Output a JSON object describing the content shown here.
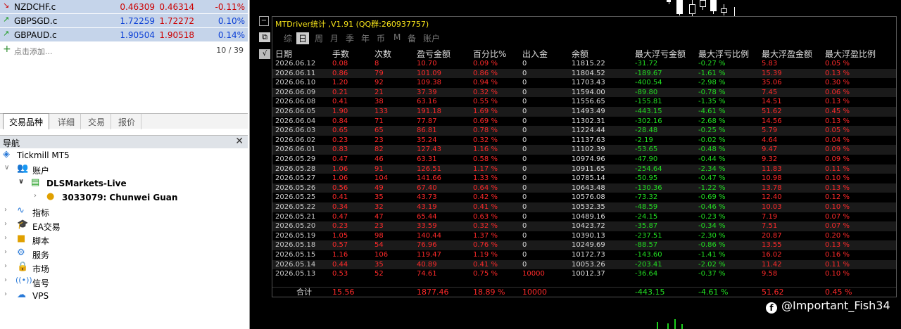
{
  "market_watch": {
    "rows": [
      {
        "dir": "down",
        "symbol": "NZDCHF.c",
        "bid": "0.46309",
        "ask": "0.46314",
        "change": "-0.11%"
      },
      {
        "dir": "up",
        "symbol": "GBPSGD.c",
        "bid": "1.72259",
        "ask": "1.72272",
        "change": "0.10%"
      },
      {
        "dir": "up",
        "symbol": "GBPAUD.c",
        "bid": "1.90504",
        "ask": "1.90518",
        "change": "0.14%"
      }
    ],
    "add_label": "点击添加...",
    "count": "10 / 39"
  },
  "bottom_tabs": [
    "交易品种",
    "详细",
    "交易",
    "报价"
  ],
  "navigator": {
    "title": "导航",
    "items": [
      {
        "label": "Tickmill MT5",
        "icon": "terminal-icon"
      },
      {
        "label": "账户",
        "icon": "accounts-icon"
      },
      {
        "label": "DLSMarkets-Live",
        "icon": "server-icon"
      },
      {
        "label": "3033079: Chunwei Guan",
        "icon": "user-icon"
      },
      {
        "label": "指标",
        "icon": "indicator-icon"
      },
      {
        "label": "EA交易",
        "icon": "expert-icon"
      },
      {
        "label": "脚本",
        "icon": "script-icon"
      },
      {
        "label": "服务",
        "icon": "service-icon"
      },
      {
        "label": "市场",
        "icon": "market-icon"
      },
      {
        "label": "信号",
        "icon": "signal-icon"
      },
      {
        "label": "VPS",
        "icon": "cloud-icon"
      }
    ]
  },
  "stats_panel": {
    "title": "MTDriver统计 ,V1.91 (QQ群:260937757)",
    "tabs": [
      "综",
      "日",
      "周",
      "月",
      "季",
      "年",
      "币",
      "M",
      "备",
      "账户"
    ],
    "active_tab": "日",
    "columns": [
      "日期",
      "手数",
      "次数",
      "盈亏金额",
      "百分比%",
      "出入金",
      "余额",
      "最大浮亏金额",
      "最大浮亏比例",
      "最大浮盈金额",
      "最大浮盈比例"
    ],
    "rows": [
      [
        "2026.06.12",
        "0.08",
        "8",
        "10.70",
        "0.09 %",
        "0",
        "11815.22",
        "-31.72",
        "-0.27 %",
        "5.83",
        "0.05 %"
      ],
      [
        "2026.06.11",
        "0.86",
        "79",
        "101.09",
        "0.86 %",
        "0",
        "11804.52",
        "-189.67",
        "-1.61 %",
        "15.39",
        "0.13 %"
      ],
      [
        "2026.06.10",
        "1.20",
        "92",
        "109.38",
        "0.94 %",
        "0",
        "11703.43",
        "-400.54",
        "-2.98 %",
        "35.06",
        "0.30 %"
      ],
      [
        "2026.06.09",
        "0.21",
        "21",
        "37.39",
        "0.32 %",
        "0",
        "11594.00",
        "-89.80",
        "-0.78 %",
        "7.45",
        "0.06 %"
      ],
      [
        "2026.06.08",
        "0.41",
        "38",
        "63.16",
        "0.55 %",
        "0",
        "11556.65",
        "-155.81",
        "-1.35 %",
        "14.51",
        "0.13 %"
      ],
      [
        "2026.06.05",
        "1.90",
        "133",
        "191.18",
        "1.69 %",
        "0",
        "11493.49",
        "-443.15",
        "-4.61 %",
        "51.62",
        "0.45 %"
      ],
      [
        "2026.06.04",
        "0.84",
        "71",
        "77.87",
        "0.69 %",
        "0",
        "11302.31",
        "-302.16",
        "-2.68 %",
        "14.56",
        "0.13 %"
      ],
      [
        "2026.06.03",
        "0.65",
        "65",
        "86.81",
        "0.78 %",
        "0",
        "11224.44",
        "-28.48",
        "-0.25 %",
        "5.79",
        "0.05 %"
      ],
      [
        "2026.06.02",
        "0.23",
        "23",
        "35.24",
        "0.32 %",
        "0",
        "11137.63",
        "-2.19",
        "-0.02 %",
        "4.64",
        "0.04 %"
      ],
      [
        "2026.06.01",
        "0.83",
        "82",
        "127.43",
        "1.16 %",
        "0",
        "11102.39",
        "-53.65",
        "-0.48 %",
        "9.47",
        "0.09 %"
      ],
      [
        "2026.05.29",
        "0.47",
        "46",
        "63.31",
        "0.58 %",
        "0",
        "10974.96",
        "-47.90",
        "-0.44 %",
        "9.32",
        "0.09 %"
      ],
      [
        "2026.05.28",
        "1.06",
        "91",
        "126.51",
        "1.17 %",
        "0",
        "10911.65",
        "-254.64",
        "-2.34 %",
        "11.83",
        "0.11 %"
      ],
      [
        "2026.05.27",
        "1.06",
        "104",
        "141.66",
        "1.33 %",
        "0",
        "10785.14",
        "-50.95",
        "-0.47 %",
        "10.98",
        "0.10 %"
      ],
      [
        "2026.05.26",
        "0.56",
        "49",
        "67.40",
        "0.64 %",
        "0",
        "10643.48",
        "-130.36",
        "-1.22 %",
        "13.78",
        "0.13 %"
      ],
      [
        "2026.05.25",
        "0.41",
        "35",
        "43.73",
        "0.42 %",
        "0",
        "10576.08",
        "-73.32",
        "-0.69 %",
        "12.40",
        "0.12 %"
      ],
      [
        "2026.05.22",
        "0.34",
        "32",
        "43.19",
        "0.41 %",
        "0",
        "10532.35",
        "-48.59",
        "-0.46 %",
        "10.03",
        "0.10 %"
      ],
      [
        "2026.05.21",
        "0.47",
        "47",
        "65.44",
        "0.63 %",
        "0",
        "10489.16",
        "-24.15",
        "-0.23 %",
        "7.19",
        "0.07 %"
      ],
      [
        "2026.05.20",
        "0.23",
        "23",
        "33.59",
        "0.32 %",
        "0",
        "10423.72",
        "-35.87",
        "-0.34 %",
        "7.51",
        "0.07 %"
      ],
      [
        "2026.05.19",
        "1.05",
        "98",
        "140.44",
        "1.37 %",
        "0",
        "10390.13",
        "-237.51",
        "-2.30 %",
        "20.87",
        "0.20 %"
      ],
      [
        "2026.05.18",
        "0.57",
        "54",
        "76.96",
        "0.76 %",
        "0",
        "10249.69",
        "-88.57",
        "-0.86 %",
        "13.55",
        "0.13 %"
      ],
      [
        "2026.05.15",
        "1.16",
        "106",
        "119.47",
        "1.19 %",
        "0",
        "10172.73",
        "-143.60",
        "-1.41 %",
        "16.02",
        "0.16 %"
      ],
      [
        "2026.05.14",
        "0.44",
        "35",
        "40.89",
        "0.41 %",
        "0",
        "10053.26",
        "-203.41",
        "-2.02 %",
        "11.42",
        "0.11 %"
      ],
      [
        "2026.05.13",
        "0.53",
        "52",
        "74.61",
        "0.75 %",
        "10000",
        "10012.37",
        "-36.64",
        "-0.37 %",
        "9.58",
        "0.10 %"
      ]
    ],
    "footer": [
      "合计",
      "15.56",
      "",
      "1877.46",
      "18.89 %",
      "10000",
      "",
      "-443.15",
      "-4.61 %",
      "51.62",
      "0.45 %"
    ]
  },
  "watermark": "@Important_Fish34",
  "colors": {
    "profit_red": "#ff2a2a",
    "loss_green": "#22dd22",
    "title_yellow": "#f7e41a",
    "row_highlight": "#c5d4ea"
  }
}
